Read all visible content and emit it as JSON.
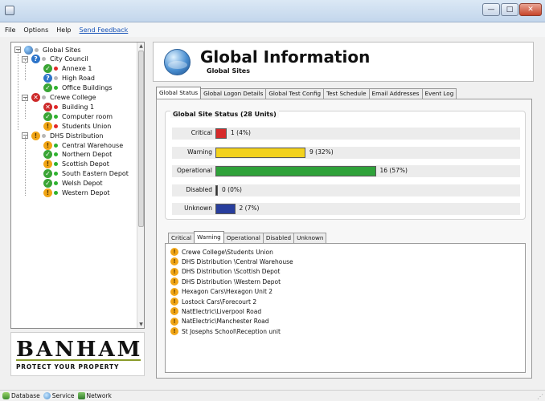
{
  "menu": {
    "items": [
      "File",
      "Options",
      "Help"
    ],
    "feedback": "Send Feedback"
  },
  "window_controls": {
    "minimize": "—",
    "maximize": "□",
    "close": "✕"
  },
  "tree": {
    "root": {
      "label": "Global Sites",
      "icon": "globe-icon"
    },
    "nodes": [
      {
        "label": "City Council",
        "status": "info",
        "dot": "grey",
        "level": 1
      },
      {
        "label": "Annexe 1",
        "status": "ok",
        "dot": "red",
        "level": 2
      },
      {
        "label": "High Road",
        "status": "info",
        "dot": "grey",
        "level": 2
      },
      {
        "label": "Office Buildings",
        "status": "ok",
        "dot": "green",
        "level": 2
      },
      {
        "label": "Crewe College",
        "status": "bad",
        "dot": "grey",
        "level": 1
      },
      {
        "label": "Building 1",
        "status": "bad",
        "dot": "red",
        "level": 2
      },
      {
        "label": "Computer room",
        "status": "ok",
        "dot": "green",
        "level": 2
      },
      {
        "label": "Students Union",
        "status": "warn",
        "dot": "red",
        "level": 2
      },
      {
        "label": "DHS Distribution",
        "status": "warn",
        "dot": "grey",
        "level": 1
      },
      {
        "label": "Central Warehouse",
        "status": "warn",
        "dot": "green",
        "level": 2
      },
      {
        "label": "Northern Depot",
        "status": "ok",
        "dot": "green",
        "level": 2
      },
      {
        "label": "Scottish Depot",
        "status": "warn",
        "dot": "green",
        "level": 2
      },
      {
        "label": "South Eastern Depot",
        "status": "ok",
        "dot": "green",
        "level": 2
      },
      {
        "label": "Welsh Depot",
        "status": "ok",
        "dot": "green",
        "level": 2
      },
      {
        "label": "Western Depot",
        "status": "warn",
        "dot": "green",
        "level": 2
      }
    ]
  },
  "logo": {
    "name": "BANHAM",
    "tagline": "PROTECT YOUR PROPERTY"
  },
  "header": {
    "title": "Global Information",
    "subtitle": "Global Sites"
  },
  "main_tabs": [
    "Global Status",
    "Global Logon Details",
    "Global Test Config",
    "Test Schedule",
    "Email Addresses",
    "Event Log"
  ],
  "active_main_tab": "Global Status",
  "status_group": {
    "title": "Global Site Status (28 Units)",
    "rows": [
      {
        "label": "Critical",
        "count": "1 (4%)",
        "fraction": 0.04,
        "color": "#d62a2a"
      },
      {
        "label": "Warning",
        "count": "9 (32%)",
        "fraction": 0.32,
        "color": "#f3d21c"
      },
      {
        "label": "Operational",
        "count": "16 (57%)",
        "fraction": 0.57,
        "color": "#2fa23a"
      },
      {
        "label": "Disabled",
        "count": "0 (0%)",
        "fraction": 0.0,
        "color": "#333333"
      },
      {
        "label": "Unknown",
        "count": "2 (7%)",
        "fraction": 0.07,
        "color": "#283e9d"
      }
    ]
  },
  "filter_tabs": [
    "Critical",
    "Warning",
    "Operational",
    "Disabled",
    "Unknown"
  ],
  "active_filter_tab": "Warning",
  "warning_list": [
    "Crewe College\\Students Union",
    "DHS Distribution \\Central Warehouse",
    "DHS Distribution \\Scottish Depot",
    "DHS Distribution \\Western Depot",
    "Hexagon Cars\\Hexagon Unit 2",
    "Lostock Cars\\Forecourt 2",
    "NatElectric\\Liverpool Road",
    "NatElectric\\Manchester Road",
    "St Josephs School\\Reception unit"
  ],
  "statusbar": [
    "Database",
    "Service",
    "Network"
  ]
}
